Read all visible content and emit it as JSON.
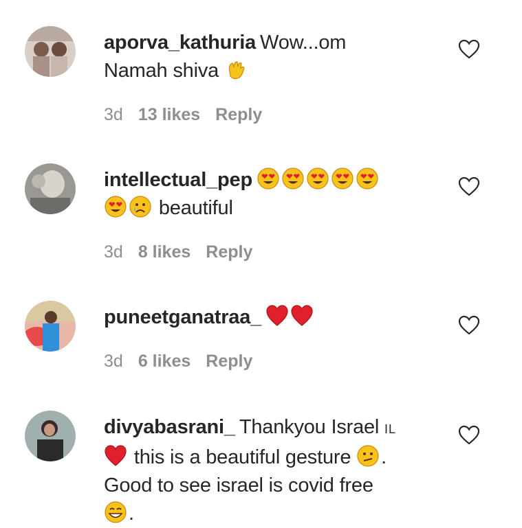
{
  "comments": [
    {
      "username": "aporva_kathuria",
      "text_line1": "Wow...om",
      "text_line2": "Namah shiva",
      "emoji": "waving-hand-icon",
      "time": "3d",
      "likes": "13 likes",
      "reply": "Reply"
    },
    {
      "username": "intellectual_pep",
      "text": "beautiful",
      "emojis": [
        "heart-eyes-emoji",
        "heart-eyes-emoji",
        "heart-eyes-emoji",
        "heart-eyes-emoji",
        "heart-eyes-emoji",
        "heart-eyes-emoji",
        "sad-tear-emoji"
      ],
      "time": "3d",
      "likes": "8 likes",
      "reply": "Reply"
    },
    {
      "username": "puneetganatraa_",
      "emojis": [
        "red-heart-icon",
        "red-heart-icon"
      ],
      "time": "3d",
      "likes": "6 likes",
      "reply": "Reply"
    },
    {
      "username": "divyabasrani_",
      "text_part1": "Thankyou Israel",
      "flag_text": "IL",
      "text_part2": "this is a beautiful gesture",
      "text_part3": ".",
      "text_line3": "Good to see israel is covid free",
      "text_end": ".",
      "emojis": [
        "red-heart-icon",
        "confused-face-emoji",
        "grinning-face-emoji"
      ]
    }
  ],
  "colors": {
    "text": "#262626",
    "meta": "#8e8e8e",
    "heart_red": "#e0202a",
    "emoji_yellow": "#f7c21b"
  }
}
